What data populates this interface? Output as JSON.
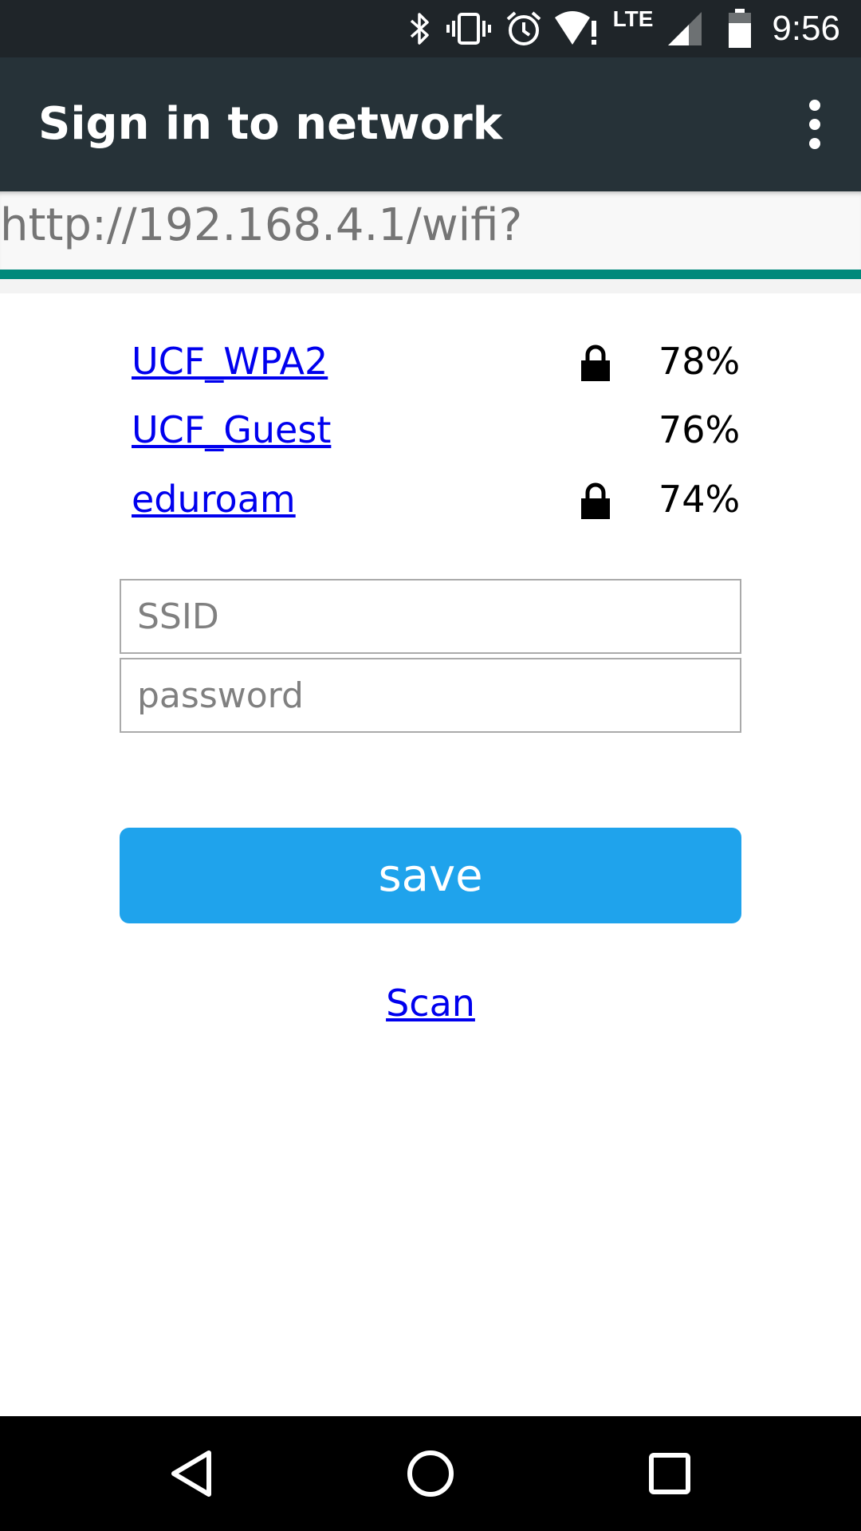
{
  "status_bar": {
    "time": "9:56",
    "network_label": "LTE",
    "icons": [
      "bluetooth-icon",
      "vibrate-icon",
      "alarm-icon",
      "wifi-no-internet-icon",
      "cell-signal-icon",
      "battery-icon"
    ]
  },
  "app_bar": {
    "title": "Sign in to network",
    "menu_icon": "more-vert-icon"
  },
  "url_bar": {
    "url": "http://192.168.4.1/wifi?",
    "page_load_progress": 1.0
  },
  "networks": [
    {
      "ssid": "UCF_WPA2",
      "secured": true,
      "signal": "78%"
    },
    {
      "ssid": "UCF_Guest",
      "secured": false,
      "signal": "76%"
    },
    {
      "ssid": "eduroam",
      "secured": true,
      "signal": "74%"
    }
  ],
  "form": {
    "ssid_placeholder": "SSID",
    "ssid_value": "",
    "password_placeholder": "password",
    "password_value": "",
    "save_label": "save",
    "scan_label": "Scan"
  },
  "nav_bar": {
    "back_icon": "back-triangle-icon",
    "home_icon": "home-circle-icon",
    "recents_icon": "recents-square-icon"
  },
  "colors": {
    "status_bar": "#1f2529",
    "app_bar": "#263238",
    "progress": "#00897b",
    "save_button": "#1fa3ec",
    "link": "#0000ee"
  }
}
